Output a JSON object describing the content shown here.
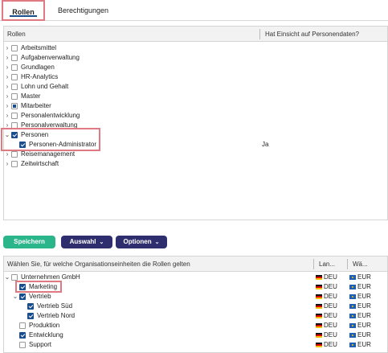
{
  "tabs": {
    "roles": "Rollen",
    "permissions": "Berechtigungen"
  },
  "roles_table": {
    "col_roles": "Rollen",
    "col_personal_data": "Hat Einsicht auf Personendaten?",
    "rows": [
      {
        "label": "Arbeitsmittel",
        "value": ""
      },
      {
        "label": "Aufgabenverwaltung",
        "value": ""
      },
      {
        "label": "Grundlagen",
        "value": ""
      },
      {
        "label": "HR-Analytics",
        "value": ""
      },
      {
        "label": "Lohn und Gehalt",
        "value": ""
      },
      {
        "label": "Master",
        "value": ""
      },
      {
        "label": "Mitarbeiter",
        "value": ""
      },
      {
        "label": "Personalentwicklung",
        "value": ""
      },
      {
        "label": "Personalverwaltung",
        "value": ""
      },
      {
        "label": "Personen",
        "value": ""
      },
      {
        "label": "Personen-Administrator",
        "value": "Ja"
      },
      {
        "label": "Reisemanagement",
        "value": ""
      },
      {
        "label": "Zeitwirtschaft",
        "value": ""
      }
    ]
  },
  "toolbar": {
    "save": "Speichern",
    "select": "Auswahl",
    "options": "Optionen"
  },
  "org_table": {
    "col_org": "Wählen Sie, für welche Organisationseinheiten die Rollen gelten",
    "col_country": "Lan...",
    "col_currency": "Wä...",
    "rows": [
      {
        "label": "Unternehmen GmbH",
        "country": "DEU",
        "currency": "EUR"
      },
      {
        "label": "Marketing",
        "country": "DEU",
        "currency": "EUR"
      },
      {
        "label": "Vertrieb",
        "country": "DEU",
        "currency": "EUR"
      },
      {
        "label": "Vertrieb Süd",
        "country": "DEU",
        "currency": "EUR"
      },
      {
        "label": "Vertrieb Nord",
        "country": "DEU",
        "currency": "EUR"
      },
      {
        "label": "Produktion",
        "country": "DEU",
        "currency": "EUR"
      },
      {
        "label": "Entwicklung",
        "country": "DEU",
        "currency": "EUR"
      },
      {
        "label": "Support",
        "country": "DEU",
        "currency": "EUR"
      }
    ]
  },
  "colors": {
    "accent": "#1a4d8c",
    "save_button": "#2bb58a",
    "dark_button": "#2e2e6e",
    "highlight": "#e07a82"
  }
}
